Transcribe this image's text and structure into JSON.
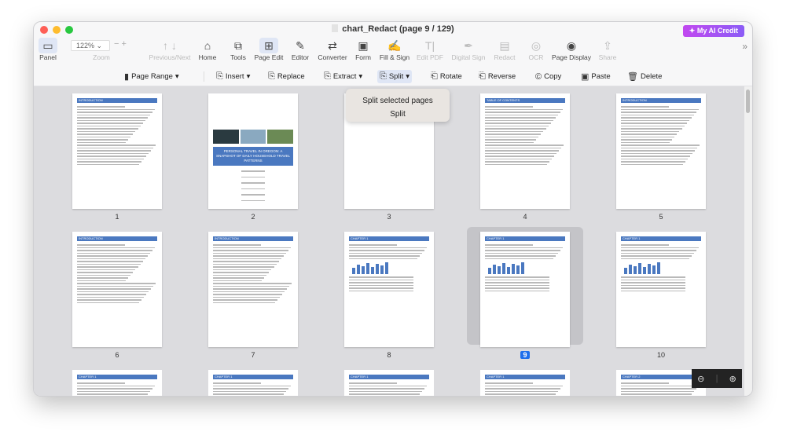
{
  "window": {
    "title": "chart_Redact (page 9 / 129)",
    "ai_button": "My AI Credit"
  },
  "toolbar": {
    "zoom_value": "122%",
    "items": [
      {
        "label": "Panel",
        "icon": "panel-icon",
        "state": "active"
      },
      {
        "label": "Zoom",
        "icon": "zoom",
        "state": "disabled"
      },
      {
        "label": "Previous/Next",
        "icon": "arrows-icon",
        "state": "disabled"
      },
      {
        "label": "Home",
        "icon": "home-icon",
        "state": "normal"
      },
      {
        "label": "Tools",
        "icon": "toolbox-icon",
        "state": "normal"
      },
      {
        "label": "Page Edit",
        "icon": "grid-icon",
        "state": "active"
      },
      {
        "label": "Editor",
        "icon": "edit-icon",
        "state": "normal"
      },
      {
        "label": "Converter",
        "icon": "convert-icon",
        "state": "normal"
      },
      {
        "label": "Form",
        "icon": "form-icon",
        "state": "normal"
      },
      {
        "label": "Fill & Sign",
        "icon": "sign-icon",
        "state": "normal"
      },
      {
        "label": "Edit PDF",
        "icon": "text-icon",
        "state": "disabled"
      },
      {
        "label": "Digital Sign",
        "icon": "pen-icon",
        "state": "disabled"
      },
      {
        "label": "Redact",
        "icon": "redact-icon",
        "state": "disabled"
      },
      {
        "label": "OCR",
        "icon": "ocr-icon",
        "state": "disabled"
      },
      {
        "label": "Page Display",
        "icon": "eye-icon",
        "state": "normal"
      },
      {
        "label": "Share",
        "icon": "share-icon",
        "state": "disabled"
      }
    ]
  },
  "page_edit": {
    "page_range": "Page Range",
    "insert": "Insert",
    "replace": "Replace",
    "extract": "Extract",
    "split": "Split",
    "rotate": "Rotate",
    "reverse": "Reverse",
    "copy": "Copy",
    "paste": "Paste",
    "delete": "Delete"
  },
  "split_menu": {
    "items": [
      "Split selected pages",
      "Split"
    ]
  },
  "pages": [
    {
      "n": "1",
      "header": "INTRODUCTION"
    },
    {
      "n": "2",
      "cover": "PERSONAL TRAVEL IN OREGON: A SNAPSHOT OF DAILY HOUSEHOLD TRAVEL PATTERNS"
    },
    {
      "n": "3"
    },
    {
      "n": "4",
      "header": "TABLE OF CONTENTS"
    },
    {
      "n": "5",
      "header": "INTRODUCTION"
    },
    {
      "n": "6",
      "header": "INTRODUCTION"
    },
    {
      "n": "7",
      "header": "INTRODUCTION"
    },
    {
      "n": "8",
      "header": "CHAPTER 1"
    },
    {
      "n": "9",
      "header": "CHAPTER 1",
      "selected": true
    },
    {
      "n": "10",
      "header": "CHAPTER 1"
    },
    {
      "header": "CHAPTER 1"
    },
    {
      "header": "CHAPTER 1"
    },
    {
      "header": "CHAPTER 1"
    },
    {
      "header": "CHAPTER 1"
    },
    {
      "header": "CHAPTER 2"
    }
  ],
  "accent": "#1f6feb"
}
